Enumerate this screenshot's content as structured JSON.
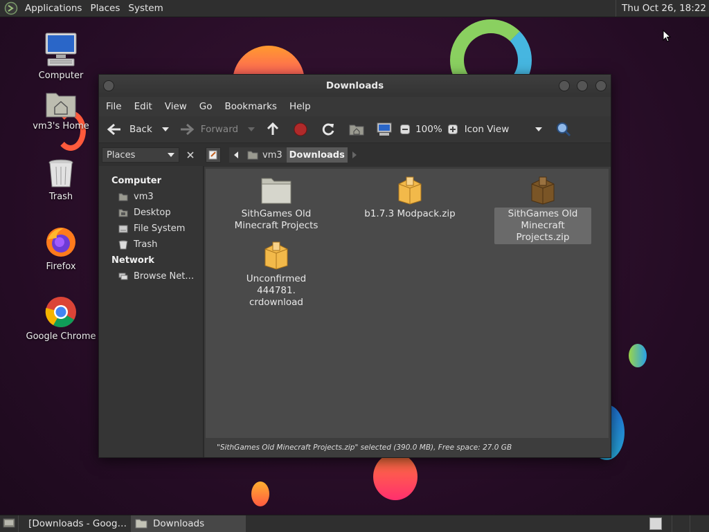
{
  "top_panel": {
    "menus": [
      "Applications",
      "Places",
      "System"
    ],
    "clock": "Thu Oct 26, 18:22"
  },
  "desktop": {
    "icons": [
      {
        "label": "Computer",
        "icon": "computer-icon"
      },
      {
        "label": "vm3's Home",
        "icon": "home-folder-icon"
      },
      {
        "label": "Trash",
        "icon": "trash-icon"
      },
      {
        "label": "Firefox",
        "icon": "firefox-icon"
      },
      {
        "label": "Google Chrome",
        "icon": "chrome-icon"
      }
    ]
  },
  "window": {
    "title": "Downloads",
    "menus": [
      "File",
      "Edit",
      "View",
      "Go",
      "Bookmarks",
      "Help"
    ],
    "toolbar": {
      "back": "Back",
      "forward": "Forward",
      "zoom": "100%",
      "view_mode": "Icon View"
    },
    "location": {
      "crumbs": [
        "vm3",
        "Downloads"
      ]
    },
    "sidebar": {
      "selector": "Places",
      "sections": [
        {
          "title": "Computer",
          "items": [
            "vm3",
            "Desktop",
            "File System",
            "Trash"
          ]
        },
        {
          "title": "Network",
          "items": [
            "Browse Net…"
          ]
        }
      ]
    },
    "files": [
      {
        "line1": "SithGames Old",
        "line2": "Minecraft Projects",
        "type": "folder-icon"
      },
      {
        "line1": "b1.7.3 Modpack.zip",
        "line2": "",
        "type": "archive-icon"
      },
      {
        "line1": "SithGames Old",
        "line2": "Minecraft Projects.zip",
        "type": "archive-icon",
        "selected": true
      },
      {
        "line1": "Unconfirmed 444781.",
        "line2": "crdownload",
        "type": "archive-icon"
      }
    ],
    "status": "\"SithGames Old Minecraft Projects.zip\" selected (390.0 MB), Free space: 27.0 GB"
  },
  "bottom_panel": {
    "tasks": [
      "[Downloads - Goog…",
      "Downloads"
    ]
  },
  "colors": {
    "panel": "#2f2f2f",
    "window_bg": "#3c3c3c",
    "content_bg": "#4a4a4a",
    "selection": "#6a6a6a",
    "stop_red": "#c0392b"
  }
}
